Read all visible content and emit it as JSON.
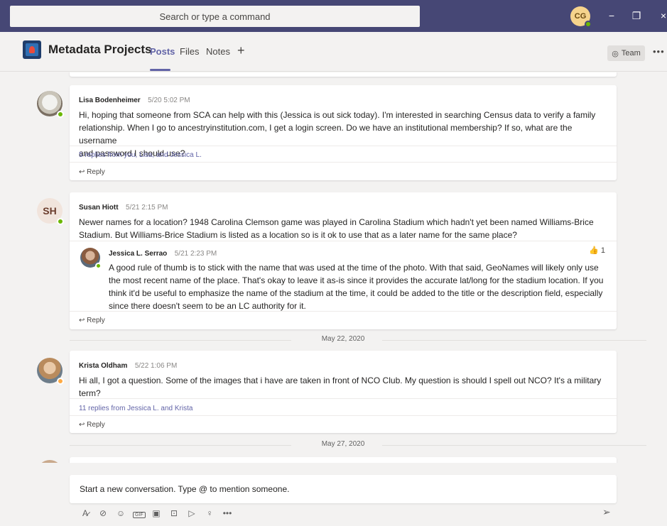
{
  "titlebar": {
    "search_placeholder": "Search or type a command",
    "user_initials": "CG",
    "minimize": "−",
    "maximize": "❐",
    "close": "×"
  },
  "channel": {
    "title": "Metadata Projects",
    "tabs": [
      {
        "label": "Posts",
        "active": true
      },
      {
        "label": "Files",
        "active": false
      },
      {
        "label": "Notes",
        "active": false
      }
    ],
    "add_tab": "+",
    "team_button": "Team",
    "more": "•••"
  },
  "posts": [
    {
      "author": "Lisa Bodenheimer",
      "time": "5/20 5:02 PM",
      "lines": [
        "Hi, hoping that someone from SCA can help with this (Jessica is out sick today). I'm interested in searching Census data to verify a family",
        "relationship. When I go to ancestryinstitution.com, I get a login screen. Do we have an institutional membership? If so, what are the username",
        "and password I should use?"
      ],
      "replies_summary": "5 replies from you, Lisa, and Jessica L.",
      "reply_label": "Reply"
    },
    {
      "author": "Susan Hiott",
      "initials": "SH",
      "time": "5/21 2:15 PM",
      "lines": [
        "Newer names for a location? 1948 Carolina Clemson game was played in Carolina Stadium which hadn't yet been named Williams-Brice",
        "Stadium. But Williams-Brice Stadium is listed as a location so is it ok to use that as a later name for the same place?"
      ],
      "reply": {
        "author": "Jessica L. Serrao",
        "time": "5/21 2:23 PM",
        "likes": "1",
        "lines": [
          "A good rule of thumb is to stick with the name that was used at the time of the photo. With that said, GeoNames will likely only use",
          "the most recent name of the place. That's okay to leave it as-is since it provides the accurate lat/long for the stadium location. If you",
          "think it'd be useful to emphasize the name of the stadium at the time, it could be added to the title or the description field, especially",
          "since there doesn't seem to be an LC authority for it."
        ]
      },
      "reply_label": "Reply"
    },
    {
      "author": "Krista Oldham",
      "time": "5/22 1:06 PM",
      "lines": [
        "Hi all, I got a question. Some of the images that i have are taken in front of NCO Club. My question is should I spell out NCO? It's a military",
        "term?"
      ],
      "replies_summary": "11 replies from Jessica L. and Krista",
      "reply_label": "Reply"
    }
  ],
  "date_separators": [
    "May 22, 2020",
    "May 27, 2020"
  ],
  "compose": {
    "placeholder": "Start a new conversation. Type @ to mention someone.",
    "tools": [
      "format-icon",
      "attach-icon",
      "emoji-icon",
      "gif-icon",
      "sticker-icon",
      "meet-icon",
      "stream-icon",
      "praise-icon",
      "more-icon"
    ],
    "gif_label": "GIF",
    "more_label": "•••"
  },
  "colors": {
    "titlebar": "#464775",
    "accent": "#6264a7",
    "presence_available": "#6bb700",
    "presence_away": "#ffaa44"
  }
}
